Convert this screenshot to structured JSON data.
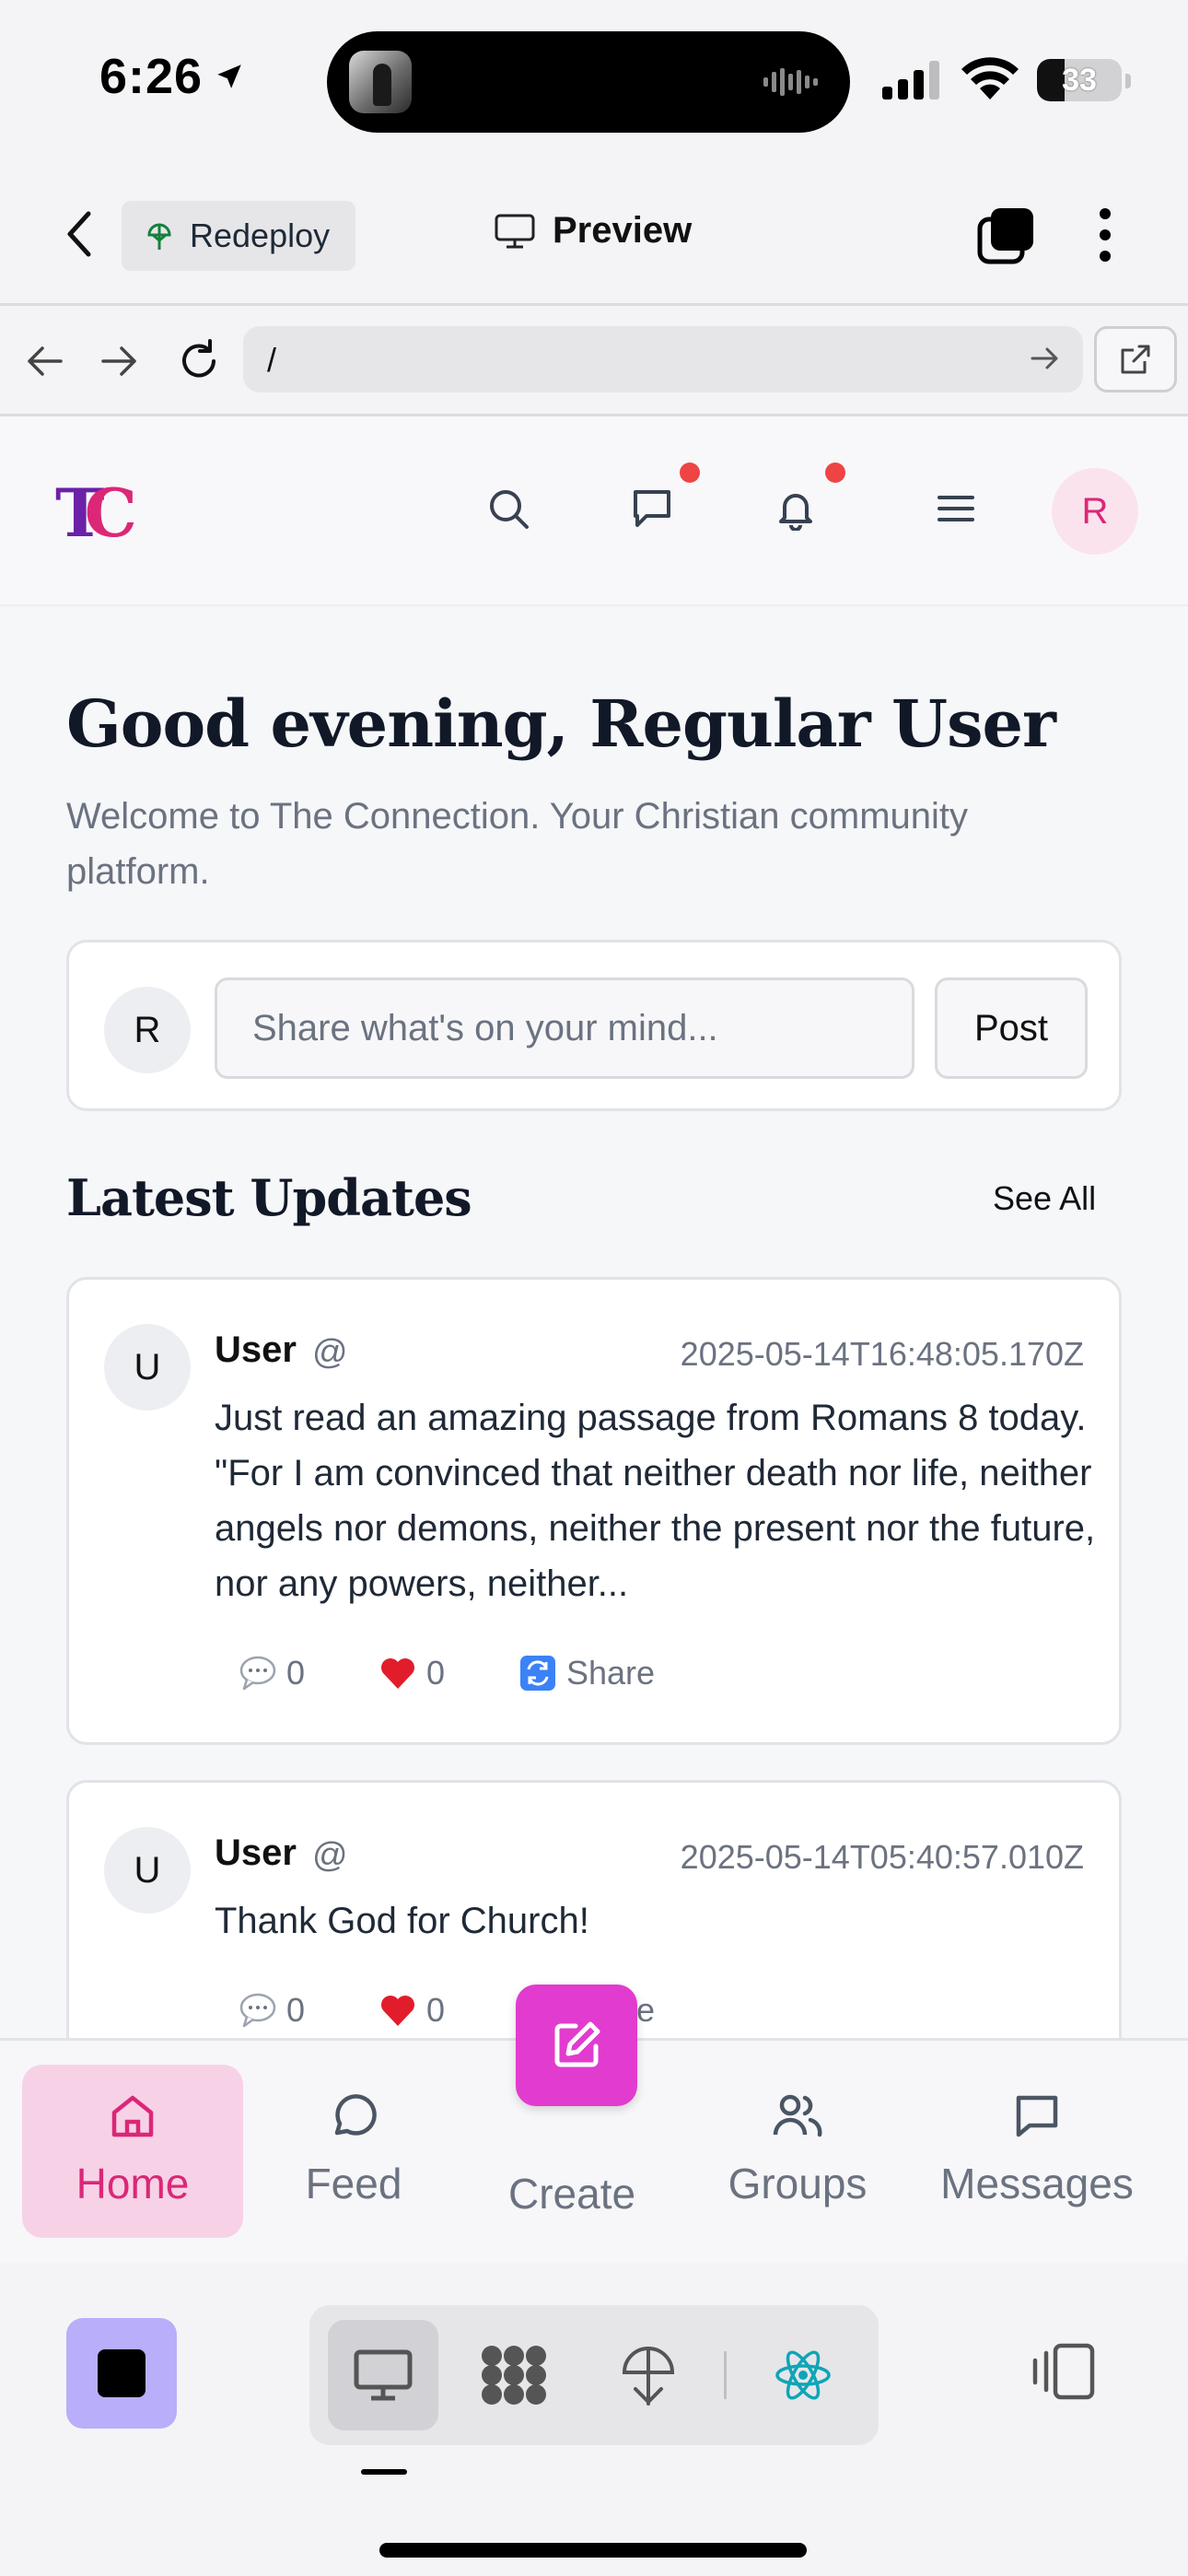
{
  "status_bar": {
    "time": "6:26",
    "battery_level": "33",
    "battery_fraction": 0.33
  },
  "top_bar": {
    "redeploy_label": "Redeploy",
    "preview_label": "Preview"
  },
  "url_bar": {
    "url": "/"
  },
  "site": {
    "logo_text": "TC",
    "avatar_initial": "R",
    "greeting": "Good evening, Regular User",
    "welcome": "Welcome to The Connection. Your Christian community platform.",
    "composer": {
      "avatar_initial": "R",
      "placeholder": "Share what's on your mind...",
      "post_label": "Post"
    },
    "updates": {
      "title": "Latest Updates",
      "see_all": "See All",
      "posts": [
        {
          "avatar": "U",
          "author": "User",
          "handle": "@",
          "timestamp": "2025-05-14T16:48:05.170Z",
          "body": "Just read an amazing passage from Romans 8 today. \"For I am convinced that neither death nor life, neither angels nor demons, neither the present nor the future, nor any powers, neither...",
          "comments": "0",
          "likes": "0",
          "share": "Share"
        },
        {
          "avatar": "U",
          "author": "User",
          "handle": "@",
          "timestamp": "2025-05-14T05:40:57.010Z",
          "body": "Thank God for Church!",
          "comments": "0",
          "likes": "0",
          "share": "Share"
        }
      ]
    }
  },
  "bottom_nav": {
    "items": [
      {
        "label": "Home",
        "icon": "home-icon"
      },
      {
        "label": "Feed",
        "icon": "chat-bubble-icon"
      },
      {
        "label": "Create",
        "icon": "edit-icon"
      },
      {
        "label": "Groups",
        "icon": "users-icon"
      },
      {
        "label": "Messages",
        "icon": "message-square-icon"
      }
    ]
  },
  "colors": {
    "accent": "#db2777",
    "fab": "#e23bcf",
    "stop_button": "#b9aef9"
  }
}
